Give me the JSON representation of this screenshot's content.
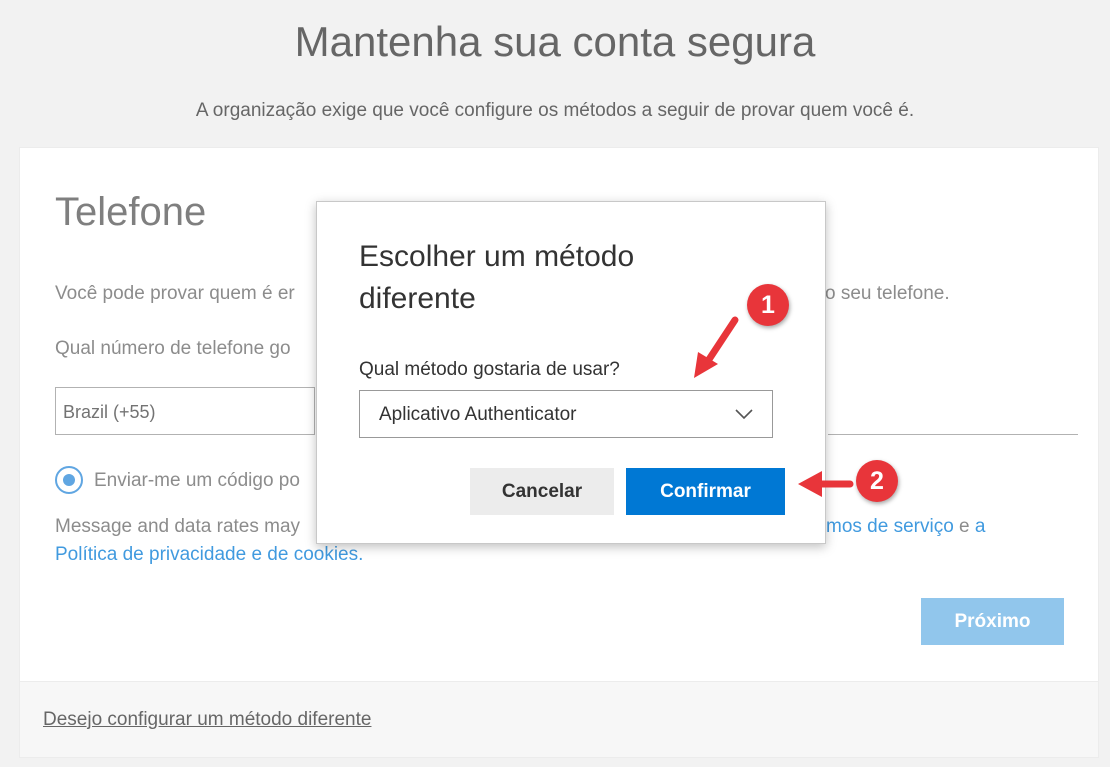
{
  "page": {
    "title": "Mantenha sua conta segura",
    "subtitle": "A organização exige que você configure os métodos a seguir de provar quem você é."
  },
  "card": {
    "section_title": "Telefone",
    "intro_left": "Você pode provar quem é er",
    "intro_right": "o seu telefone.",
    "question_left": "Qual número de telefone go",
    "country_value": "Brazil (+55)",
    "radio_label": "Enviar-me um código po",
    "rates_left": "Message and data rates may",
    "terms_link": "mos de serviço",
    "and_text": " e ",
    "a_link": "a",
    "privacy_link": "Política de privacidade e de cookies",
    "period": ".",
    "next_button": "Próximo",
    "footer_link": "Desejo configurar um método diferente"
  },
  "dialog": {
    "title": "Escolher um método diferente",
    "question": "Qual método gostaria de usar?",
    "selected_method": "Aplicativo Authenticator",
    "cancel_button": "Cancelar",
    "confirm_button": "Confirmar"
  },
  "annotations": {
    "badge_1": "1",
    "badge_2": "2",
    "color": "#e8353a"
  },
  "colors": {
    "accent": "#0078d4",
    "next_disabled": "#6cb3e6"
  }
}
